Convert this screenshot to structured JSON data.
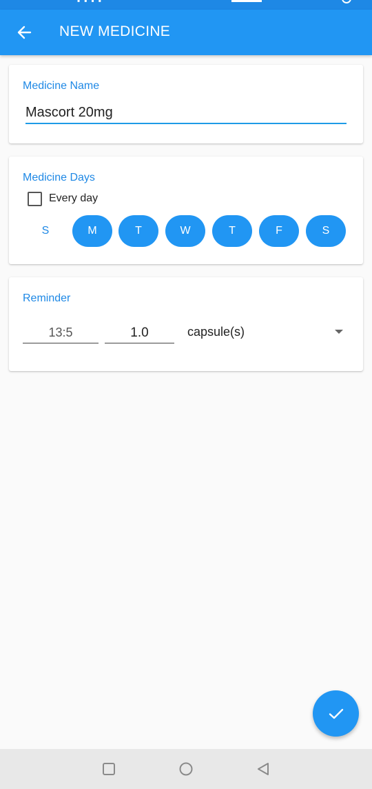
{
  "colors": {
    "primary": "#2196f3",
    "primary_dark": "#1e88e5",
    "background": "#fafafa",
    "card": "#ffffff"
  },
  "appbar": {
    "title": "NEW MEDICINE",
    "back_icon": "arrow-left-icon"
  },
  "medicine_name": {
    "label": "Medicine Name",
    "value": "Mascort 20mg"
  },
  "medicine_days": {
    "label": "Medicine Days",
    "every_day_label": "Every day",
    "every_day_checked": false,
    "days": [
      {
        "label": "S",
        "selected": false
      },
      {
        "label": "M",
        "selected": true
      },
      {
        "label": "T",
        "selected": true
      },
      {
        "label": "W",
        "selected": true
      },
      {
        "label": "T",
        "selected": true
      },
      {
        "label": "F",
        "selected": true
      },
      {
        "label": "S",
        "selected": true
      }
    ]
  },
  "reminder": {
    "label": "Reminder",
    "time": "13:5",
    "dose": "1.0",
    "unit": "capsule(s)"
  },
  "fab": {
    "icon": "checkmark-icon"
  },
  "navbar": {
    "icons": [
      "recent-apps-icon",
      "home-icon",
      "back-triangle-icon"
    ]
  }
}
